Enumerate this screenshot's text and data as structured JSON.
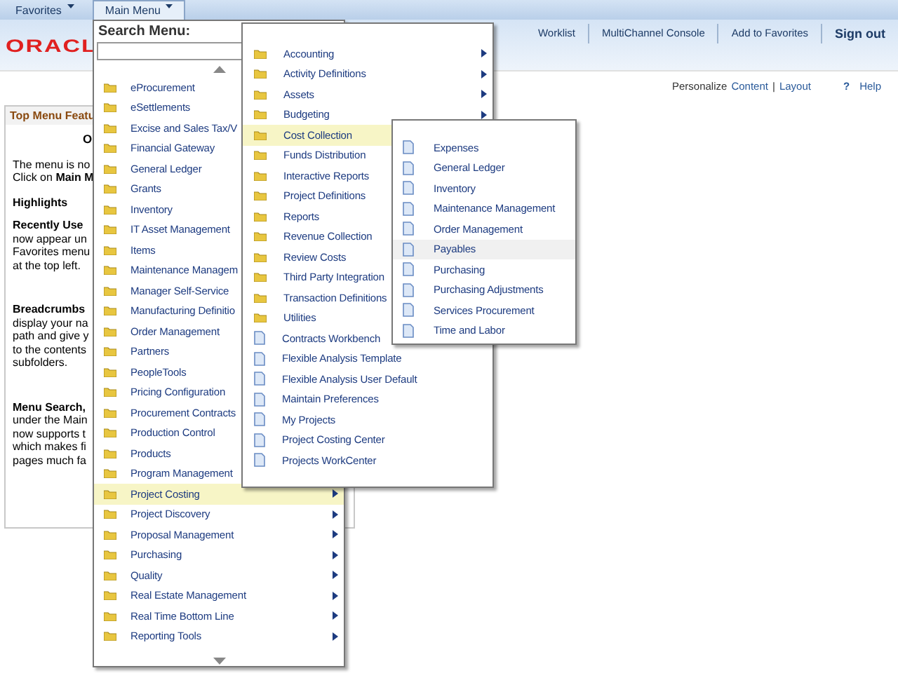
{
  "top_tabs": [
    {
      "label": "Favorites",
      "selected": false
    },
    {
      "label": "Main Menu",
      "selected": true
    }
  ],
  "header": {
    "logo": "ORACL",
    "links": [
      {
        "label": "Worklist",
        "bold": false
      },
      {
        "label": "MultiChannel Console",
        "bold": false
      },
      {
        "label": "Add to Favorites",
        "bold": false
      },
      {
        "label": "Sign out",
        "bold": true
      }
    ]
  },
  "page_tools": {
    "personalize": "Personalize",
    "content": "Content",
    "separator": "|",
    "layout": "Layout",
    "help_icon": "?",
    "help": "Help"
  },
  "pagelet": {
    "title": "Top Menu Featu",
    "heading": "O",
    "intro": [
      "The menu is no",
      "Click on **Main M**"
    ],
    "highlights": "Highlights",
    "sections": [
      {
        "title": "Recently Use",
        "lines": [
          "now appear un",
          "Favorites menu",
          "at the top left."
        ]
      },
      {
        "title": "Breadcrumbs",
        "lines": [
          "display your na",
          "path and give y",
          "to the contents",
          "subfolders."
        ]
      },
      {
        "title": "Menu Search,",
        "lines": [
          "under the Main",
          "now supports t",
          "which makes fi",
          "pages much fa"
        ]
      }
    ]
  },
  "main_menu": {
    "search_label": "Search Menu:",
    "items": [
      {
        "label": "eProcurement",
        "selected": false
      },
      {
        "label": "eSettlements",
        "selected": false
      },
      {
        "label": "Excise and Sales Tax/V",
        "selected": false
      },
      {
        "label": "Financial Gateway",
        "selected": false
      },
      {
        "label": "General Ledger",
        "selected": false
      },
      {
        "label": "Grants",
        "selected": false
      },
      {
        "label": "Inventory",
        "selected": false
      },
      {
        "label": "IT Asset Management",
        "selected": false
      },
      {
        "label": "Items",
        "selected": false
      },
      {
        "label": "Maintenance Managem",
        "selected": false
      },
      {
        "label": "Manager Self-Service",
        "selected": false
      },
      {
        "label": "Manufacturing Definitio",
        "selected": false
      },
      {
        "label": "Order Management",
        "selected": false
      },
      {
        "label": "Partners",
        "selected": false
      },
      {
        "label": "PeopleTools",
        "selected": false
      },
      {
        "label": "Pricing Configuration",
        "selected": false
      },
      {
        "label": "Procurement Contracts",
        "selected": false
      },
      {
        "label": "Production Control",
        "selected": false
      },
      {
        "label": "Products",
        "selected": false
      },
      {
        "label": "Program Management",
        "selected": false
      },
      {
        "label": "Project Costing",
        "selected": true,
        "submenu": true
      },
      {
        "label": "Project Discovery",
        "selected": false,
        "submenu": true
      },
      {
        "label": "Proposal Management",
        "selected": false,
        "submenu": true
      },
      {
        "label": "Purchasing",
        "selected": false,
        "submenu": true
      },
      {
        "label": "Quality",
        "selected": false,
        "submenu": true
      },
      {
        "label": "Real Estate Management",
        "selected": false,
        "submenu": true
      },
      {
        "label": "Real Time Bottom Line",
        "selected": false,
        "submenu": true
      },
      {
        "label": "Reporting Tools",
        "selected": false,
        "submenu": true
      }
    ]
  },
  "project_costing_menu": {
    "items": [
      {
        "label": "Accounting",
        "kind": "folder",
        "selected": false,
        "submenu": true
      },
      {
        "label": "Activity Definitions",
        "kind": "folder",
        "selected": false,
        "submenu": true
      },
      {
        "label": "Assets",
        "kind": "folder",
        "selected": false,
        "submenu": true
      },
      {
        "label": "Budgeting",
        "kind": "folder",
        "selected": false,
        "submenu": true
      },
      {
        "label": "Cost Collection",
        "kind": "folder",
        "selected": true
      },
      {
        "label": "Funds Distribution",
        "kind": "folder",
        "selected": false
      },
      {
        "label": "Interactive Reports",
        "kind": "folder",
        "selected": false
      },
      {
        "label": "Project Definitions",
        "kind": "folder",
        "selected": false
      },
      {
        "label": "Reports",
        "kind": "folder",
        "selected": false
      },
      {
        "label": "Revenue Collection",
        "kind": "folder",
        "selected": false
      },
      {
        "label": "Review Costs",
        "kind": "folder",
        "selected": false
      },
      {
        "label": "Third Party Integration",
        "kind": "folder",
        "selected": false
      },
      {
        "label": "Transaction Definitions",
        "kind": "folder",
        "selected": false
      },
      {
        "label": "Utilities",
        "kind": "folder",
        "selected": false
      },
      {
        "label": "Contracts Workbench",
        "kind": "page",
        "selected": false
      },
      {
        "label": "Flexible Analysis Template",
        "kind": "page",
        "selected": false
      },
      {
        "label": "Flexible Analysis User Default",
        "kind": "page",
        "selected": false
      },
      {
        "label": "Maintain Preferences",
        "kind": "page",
        "selected": false
      },
      {
        "label": "My Projects",
        "kind": "page",
        "selected": false
      },
      {
        "label": "Project Costing Center",
        "kind": "page",
        "selected": false
      },
      {
        "label": "Projects WorkCenter",
        "kind": "page",
        "selected": false
      }
    ]
  },
  "cost_collection_menu": {
    "items": [
      {
        "label": "Expenses",
        "kind": "page",
        "selected": false
      },
      {
        "label": "General Ledger",
        "kind": "page",
        "selected": false
      },
      {
        "label": "Inventory",
        "kind": "page",
        "selected": false
      },
      {
        "label": "Maintenance Management",
        "kind": "page",
        "selected": false
      },
      {
        "label": "Order Management",
        "kind": "page",
        "selected": false
      },
      {
        "label": "Payables",
        "kind": "page",
        "selected": true
      },
      {
        "label": "Purchasing",
        "kind": "page",
        "selected": false
      },
      {
        "label": "Purchasing Adjustments",
        "kind": "page",
        "selected": false
      },
      {
        "label": "Services Procurement",
        "kind": "page",
        "selected": false
      },
      {
        "label": "Time and Labor",
        "kind": "page",
        "selected": false
      }
    ]
  }
}
